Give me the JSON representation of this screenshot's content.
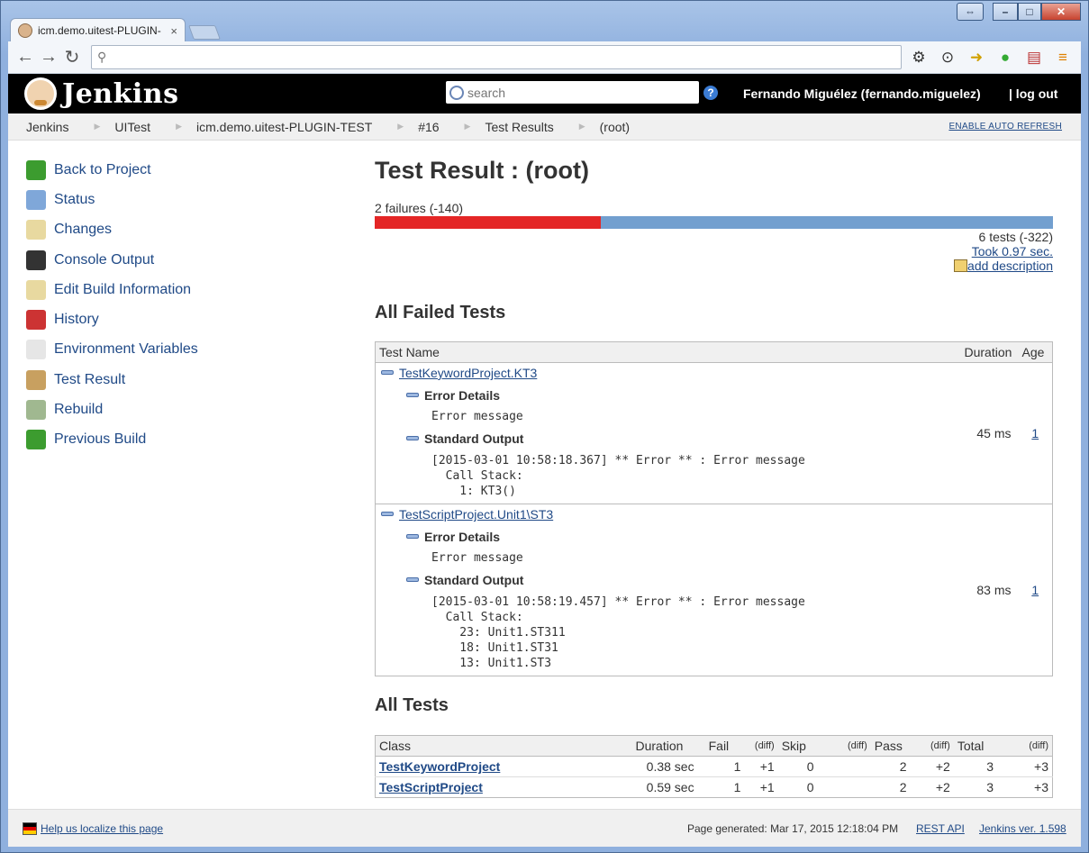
{
  "browser": {
    "tab_title": "icm.demo.uitest-PLUGIN-",
    "tab_close": "×",
    "url": "",
    "window_controls": [
      "⇔",
      "–",
      "□",
      "✕"
    ]
  },
  "header": {
    "logo": "Jenkins",
    "search_placeholder": "search",
    "help": "?",
    "user": "Fernando Miguélez (fernando.miguelez)",
    "logout": "| log out"
  },
  "breadcrumb": {
    "items": [
      "Jenkins",
      "UITest",
      "icm.demo.uitest-PLUGIN-TEST",
      "#16",
      "Test Results",
      "(root)"
    ],
    "auto_refresh": "ENABLE AUTO REFRESH"
  },
  "sidebar": {
    "items": [
      {
        "label": "Back to Project",
        "icon": "up-arrow-icon",
        "color": "#3c9c2f"
      },
      {
        "label": "Status",
        "icon": "magnifier-icon",
        "color": "#7fa7d9"
      },
      {
        "label": "Changes",
        "icon": "notepad-icon",
        "color": "#e8d9a0"
      },
      {
        "label": "Console Output",
        "icon": "terminal-icon",
        "color": "#333333"
      },
      {
        "label": "Edit Build Information",
        "icon": "notepad-icon",
        "color": "#e8d9a0"
      },
      {
        "label": "History",
        "icon": "history-icon",
        "color": "#cc3333"
      },
      {
        "label": "Environment Variables",
        "icon": "document-icon",
        "color": "#e6e6e6"
      },
      {
        "label": "Test Result",
        "icon": "clipboard-icon",
        "color": "#c8a060"
      },
      {
        "label": "Rebuild",
        "icon": "clock-icon",
        "color": "#a0b890"
      },
      {
        "label": "Previous Build",
        "icon": "left-arrow-icon",
        "color": "#3c9c2f"
      }
    ]
  },
  "main": {
    "title": "Test Result : (root)",
    "fail_summary": "2 failures (-140)",
    "fail_fraction": 0.333,
    "tests_summary": "6 tests (-322)",
    "took": "Took 0.97 sec.",
    "add_description": "add description",
    "failed_heading": "All Failed Tests",
    "failed_table": {
      "headers": [
        "Test Name",
        "Duration",
        "Age"
      ],
      "error_details": "Error Details",
      "standard_output": "Standard Output",
      "rows": [
        {
          "name": "TestKeywordProject.KT3",
          "error": "Error message",
          "output": "[2015-03-01 10:58:18.367] ** Error ** : Error message\n  Call Stack:\n    1: KT3()",
          "duration": "45 ms",
          "age": "1"
        },
        {
          "name": "TestScriptProject.Unit1\\ST3",
          "error": "Error message",
          "output": "[2015-03-01 10:58:19.457] ** Error ** : Error message\n  Call Stack:\n    23: Unit1.ST311\n    18: Unit1.ST31\n    13: Unit1.ST3",
          "duration": "83 ms",
          "age": "1"
        }
      ]
    },
    "all_heading": "All Tests",
    "all_table": {
      "headers": [
        "Class",
        "Duration",
        "Fail",
        "(diff)",
        "Skip",
        "(diff)",
        "Pass",
        "(diff)",
        "Total",
        "(diff)"
      ],
      "rows": [
        {
          "cls": "TestKeywordProject",
          "duration": "0.38 sec",
          "fail": "1",
          "fail_diff": "+1",
          "skip": "0",
          "skip_diff": "",
          "pass": "2",
          "pass_diff": "+2",
          "total": "3",
          "total_diff": "+3"
        },
        {
          "cls": "TestScriptProject",
          "duration": "0.59 sec",
          "fail": "1",
          "fail_diff": "+1",
          "skip": "0",
          "skip_diff": "",
          "pass": "2",
          "pass_diff": "+2",
          "total": "3",
          "total_diff": "+3"
        }
      ]
    }
  },
  "footer": {
    "localize": "Help us localize this page",
    "generated": "Page generated: Mar 17, 2015 12:18:04 PM",
    "rest_api": "REST API",
    "version": "Jenkins ver. 1.598"
  }
}
